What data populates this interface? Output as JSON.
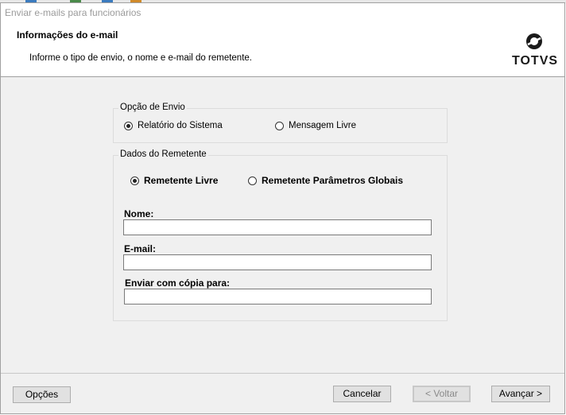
{
  "window": {
    "title": "Enviar e-mails para funcionários"
  },
  "header": {
    "title": "Informações do e-mail",
    "subtitle": "Informe o tipo de envio, o nome e e-mail do remetente.",
    "logo_text": "TOTVS"
  },
  "envio": {
    "group_label": "Opção de Envio",
    "options": [
      {
        "label": "Relatório do Sistema",
        "checked": true
      },
      {
        "label": "Mensagem Livre",
        "checked": false
      }
    ]
  },
  "remetente": {
    "group_label": "Dados do Remetente",
    "options": [
      {
        "label": "Remetente Livre",
        "checked": true
      },
      {
        "label": "Remetente Parâmetros Globais",
        "checked": false
      }
    ],
    "fields": [
      {
        "label": "Nome:",
        "value": ""
      },
      {
        "label": "E-mail:",
        "value": ""
      },
      {
        "label": "Enviar com cópia para:",
        "value": ""
      }
    ]
  },
  "footer": {
    "options_label": "Opções",
    "cancel_label": "Cancelar",
    "back_label": "< Voltar",
    "next_label": "Avançar >"
  },
  "colors": {
    "window_bg": "#f0f0f0",
    "header_bg": "#ffffff",
    "title_text": "#9b9b9b"
  },
  "icons": {
    "logo": "totvs-logo-icon"
  }
}
